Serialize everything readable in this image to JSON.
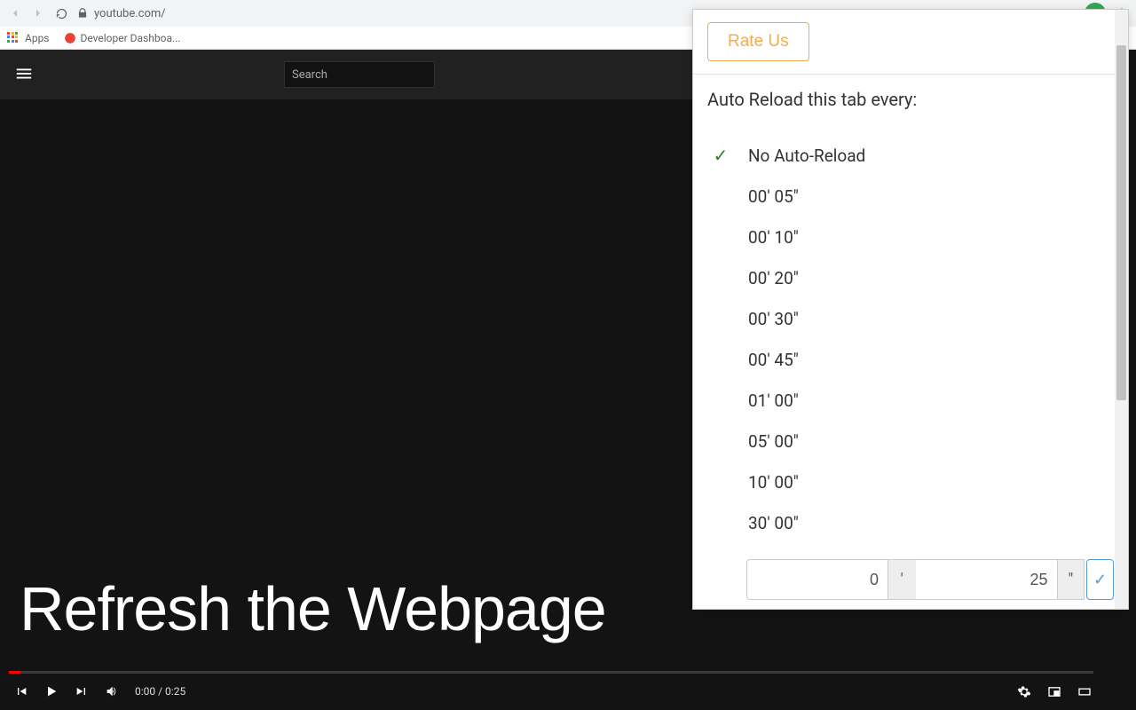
{
  "browser": {
    "url": "youtube.com/",
    "apps_label": "Apps",
    "bookmark1": "Developer Dashboa..."
  },
  "yt": {
    "search_placeholder": "Search"
  },
  "page": {
    "big_title": "Refresh the Webpage"
  },
  "player": {
    "time": "0:00 / 0:25"
  },
  "popup": {
    "rate_label": "Rate Us",
    "section_title": "Auto Reload this tab every:",
    "options": {
      "0": "No Auto-Reload",
      "1": "00' 05\"",
      "2": "00' 10\"",
      "3": "00' 20\"",
      "4": "00' 30\"",
      "5": "00' 45\"",
      "6": "01' 00\"",
      "7": "05' 00\"",
      "8": "10' 00\"",
      "9": "30' 00\""
    },
    "check": "✓",
    "custom": {
      "minutes": "0",
      "seconds": "25",
      "min_unit": "'",
      "sec_unit": "\"",
      "confirm": "✓"
    }
  }
}
